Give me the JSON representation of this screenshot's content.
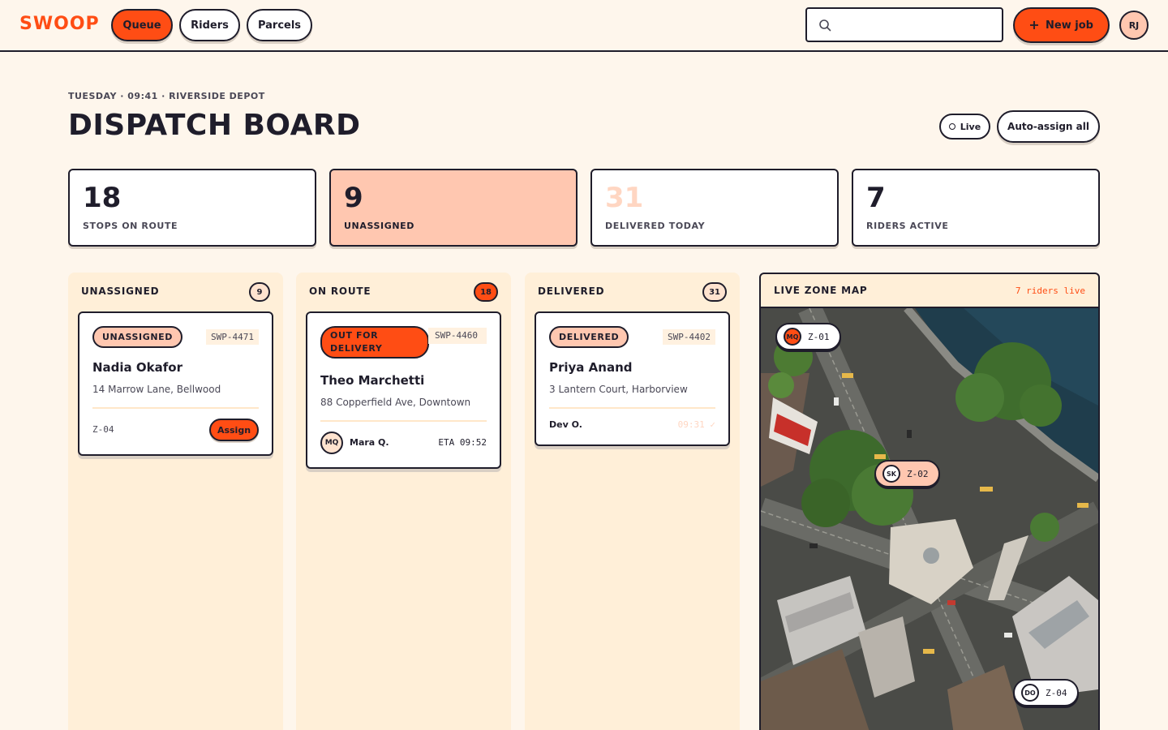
{
  "app": {
    "brand": "SWOOP"
  },
  "nav": {
    "queue": "Queue",
    "riders": "Riders",
    "parcels": "Parcels"
  },
  "search": {
    "placeholder": "",
    "value": ""
  },
  "header_actions": {
    "new_job": "New job",
    "user_initials": "RJ"
  },
  "page": {
    "eyebrow": "TUESDAY · 09:41 · RIVERSIDE DEPOT",
    "title": "DISPATCH BOARD",
    "live_label": "Live",
    "auto_assign": "Auto-assign all"
  },
  "stats": [
    {
      "value": "18",
      "label": "STOPS ON ROUTE"
    },
    {
      "value": "9",
      "label": "UNASSIGNED"
    },
    {
      "value": "31",
      "label": "DELIVERED TODAY"
    },
    {
      "value": "7",
      "label": "RIDERS ACTIVE"
    }
  ],
  "columns": {
    "unassigned": {
      "title": "UNASSIGNED",
      "count": "9",
      "card": {
        "status": "UNASSIGNED",
        "code": "SWP-4471",
        "customer": "Nadia Okafor",
        "address": "14 Marrow Lane, Bellwood",
        "zone": "Z-04",
        "action": "Assign"
      }
    },
    "on_route": {
      "title": "ON ROUTE",
      "count": "18",
      "card": {
        "status": "OUT FOR DELIVERY",
        "code": "SWP-4460",
        "customer": "Theo Marchetti",
        "address": "88 Copperfield Ave, Downtown",
        "rider_initials": "MQ",
        "rider_name": "Mara Q.",
        "eta": "ETA 09:52"
      }
    },
    "delivered": {
      "title": "DELIVERED",
      "count": "31",
      "card": {
        "status": "DELIVERED",
        "code": "SWP-4402",
        "customer": "Priya Anand",
        "address": "3 Lantern Court, Harborview",
        "rider_name": "Dev O.",
        "time": "09:31 ✓"
      }
    }
  },
  "map": {
    "title": "LIVE ZONE MAP",
    "live_count": "7 riders live",
    "tags": [
      {
        "initials": "MQ",
        "zone": "Z-01"
      },
      {
        "initials": "SK",
        "zone": "Z-02"
      },
      {
        "initials": "DO",
        "zone": "Z-04"
      }
    ]
  },
  "colors": {
    "accent": "#ff4d14",
    "peach": "#ffc7b0",
    "ink": "#1f1d2b",
    "cream": "#fef6ec"
  }
}
